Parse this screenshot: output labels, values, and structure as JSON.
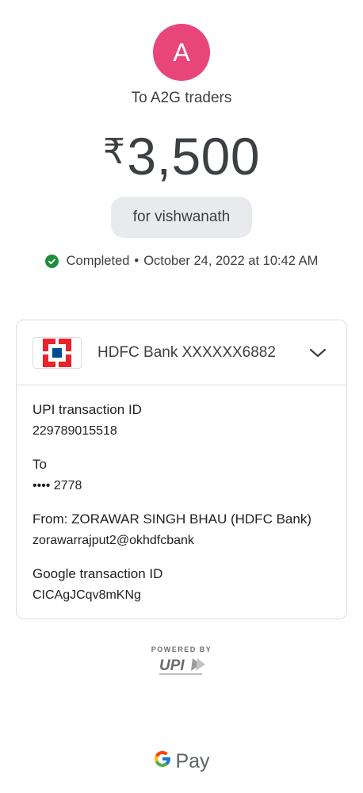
{
  "avatar": {
    "letter": "A",
    "color": "#e8467a"
  },
  "recipient": "To A2G traders",
  "amount": {
    "currency_symbol": "₹",
    "value": "3,500"
  },
  "note": "for vishwanath",
  "status": {
    "text": "Completed",
    "separator": "•",
    "datetime": "October 24, 2022 at 10:42 AM",
    "color": "#1e8e3e"
  },
  "account": {
    "bank": "HDFC Bank XXXXXX6882",
    "icon": "chevron-down-icon"
  },
  "details": [
    {
      "label": "UPI transaction ID",
      "value": "229789015518"
    },
    {
      "label": "To",
      "value": "•••• 2778"
    },
    {
      "label": "From: ZORAWAR SINGH BHAU (HDFC Bank)",
      "value": "zorawarrajput2@okhdfcbank"
    },
    {
      "label": "Google transaction ID",
      "value": "CICAgJCqv8mKNg"
    }
  ],
  "footer": {
    "powered_by": "POWERED BY",
    "upi_logo": "UPI",
    "brand": "Pay"
  }
}
